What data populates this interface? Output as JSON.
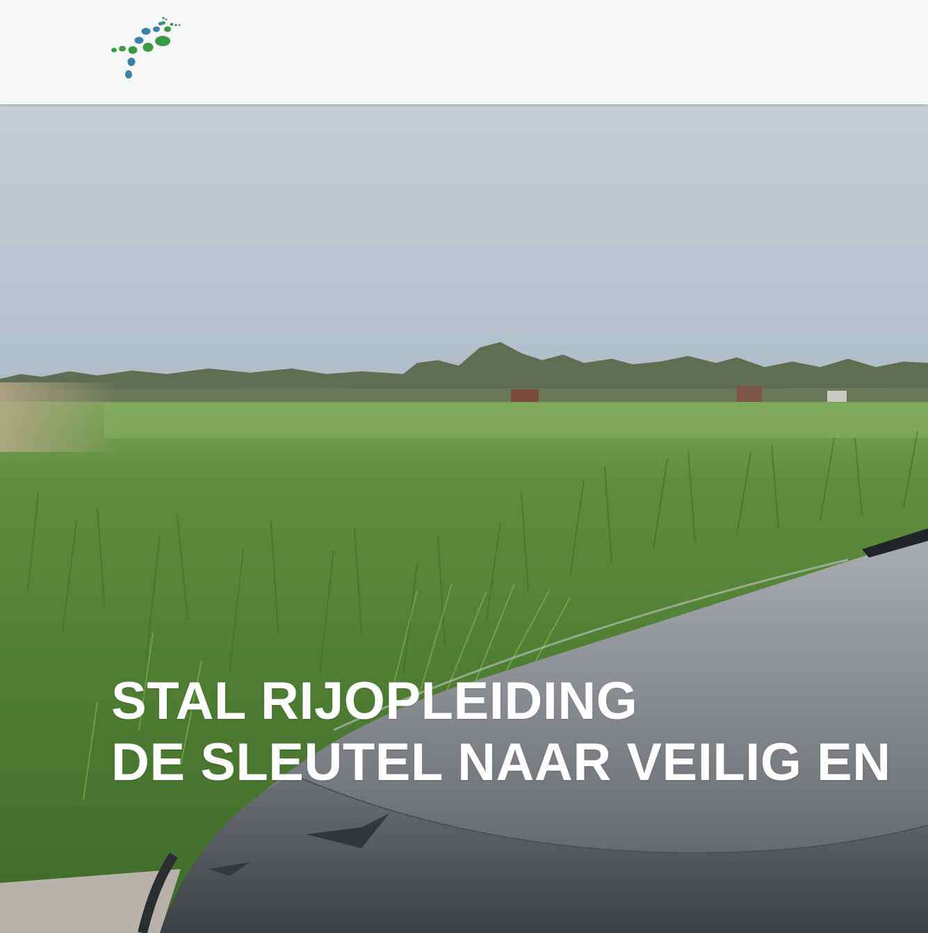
{
  "header": {
    "logo_icon": "dotted-road-logo",
    "brand_colors": {
      "blue": "#3d7fa8",
      "green": "#3a9a44"
    }
  },
  "hero": {
    "image_description_icon": "landscape-car-photo",
    "headline_line1": "STAL RIJOPLEIDING",
    "headline_line2": "DE SLEUTEL NAAR VEILIG EN"
  }
}
